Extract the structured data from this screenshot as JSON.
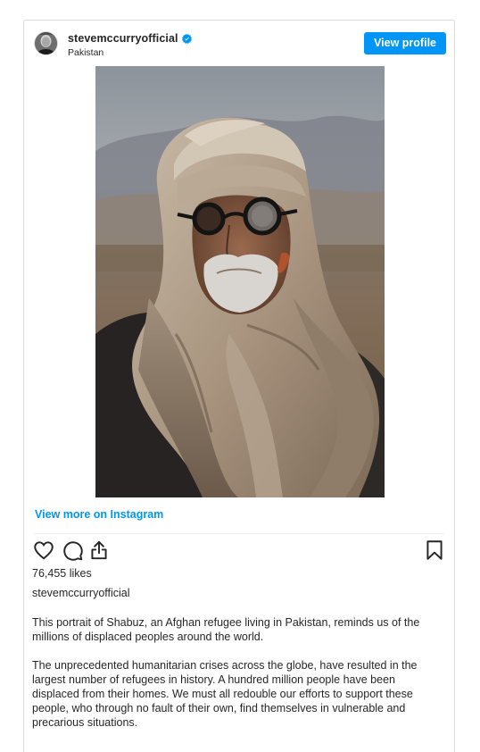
{
  "post": {
    "username": "stevemccurryofficial",
    "location": "Pakistan",
    "view_profile_label": "View profile",
    "verified_icon": "verified-badge-icon",
    "view_more_label": "View more on Instagram",
    "likes_label": "76,455 likes",
    "caption_username": "stevemccurryofficial",
    "caption_paragraphs": [
      "This portrait of Shabuz, an Afghan refugee living in Pakistan, reminds us of the millions of displaced peoples around the world.",
      "The unprecedented humanitarian crises across the globe, have resulted in the largest number of refugees in history. A hundred million people have been displaced from their homes. We must all redouble our efforts to support these people, who through no fault of their own, find themselves in vulnerable and precarious situations."
    ],
    "actions": {
      "like_icon": "heart-icon",
      "comment_icon": "comment-icon",
      "share_icon": "share-icon",
      "save_icon": "bookmark-icon"
    }
  },
  "colors": {
    "accent": "#0095f6",
    "text": "#262626",
    "border": "#dbdbdb"
  }
}
